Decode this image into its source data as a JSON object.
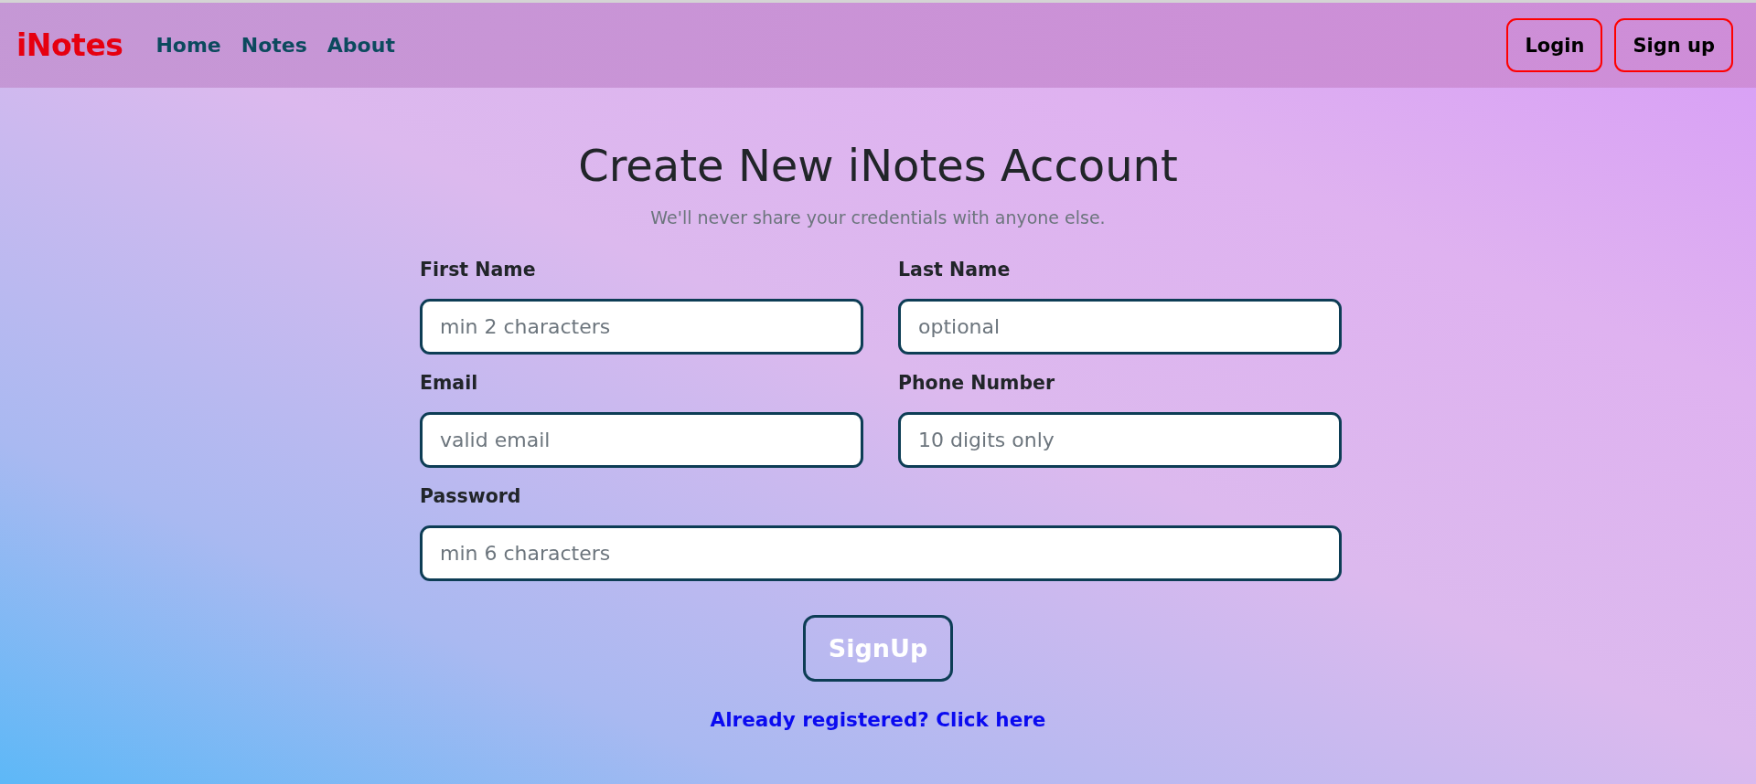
{
  "navbar": {
    "brand": "iNotes",
    "links": [
      {
        "label": "Home"
      },
      {
        "label": "Notes"
      },
      {
        "label": "About"
      }
    ],
    "buttons": [
      {
        "label": "Login"
      },
      {
        "label": "Sign up"
      }
    ]
  },
  "form": {
    "title": "Create New iNotes Account",
    "subtitle": "We'll never share your credentials with anyone else.",
    "fields": [
      {
        "label": "First Name",
        "placeholder": "min 2 characters",
        "kind": "half"
      },
      {
        "label": "Last Name",
        "placeholder": "optional",
        "kind": "half"
      },
      {
        "label": "Email",
        "placeholder": "valid email",
        "kind": "half"
      },
      {
        "label": "Phone Number",
        "placeholder": "10 digits only",
        "kind": "half"
      },
      {
        "label": "Password",
        "placeholder": "min 6 characters",
        "kind": "full"
      }
    ],
    "submit": "SignUp",
    "login_link": "Already registered? Click here"
  }
}
